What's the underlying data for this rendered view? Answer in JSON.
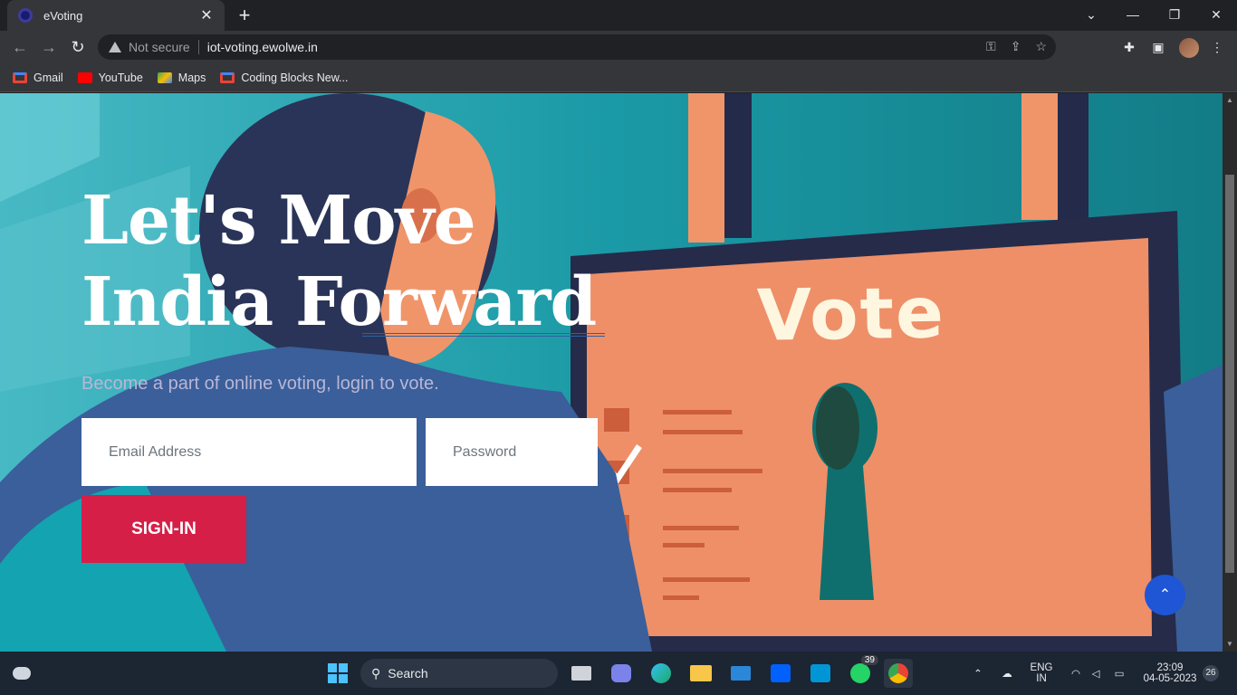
{
  "browser": {
    "tab_title": "eVoting",
    "security_label": "Not secure",
    "url": "iot-voting.ewolwe.in",
    "bookmarks": [
      {
        "label": "Gmail",
        "color": "#ea4335"
      },
      {
        "label": "YouTube",
        "color": "#ff0000"
      },
      {
        "label": "Maps",
        "color": "#34a853"
      },
      {
        "label": "Coding Blocks New...",
        "color": "#ea4335"
      }
    ]
  },
  "hero": {
    "title_line1": "Let's Move",
    "title_line2": "India Forward",
    "subtitle": "Become a part of online voting, login to vote.",
    "illustration_sign": "Vote"
  },
  "login_form": {
    "email_placeholder": "Email Address",
    "password_placeholder": "Password",
    "signin_label": "SIGN-IN"
  },
  "taskbar": {
    "search_label": "Search",
    "whatsapp_badge": "39",
    "language_line1": "ENG",
    "language_line2": "IN",
    "time": "23:09",
    "date": "04-05-2023",
    "notification_count": "26"
  },
  "colors": {
    "accent_red": "#d51f47",
    "scroll_top_blue": "#1e56d6",
    "page_teal": "#1d9ea8"
  }
}
